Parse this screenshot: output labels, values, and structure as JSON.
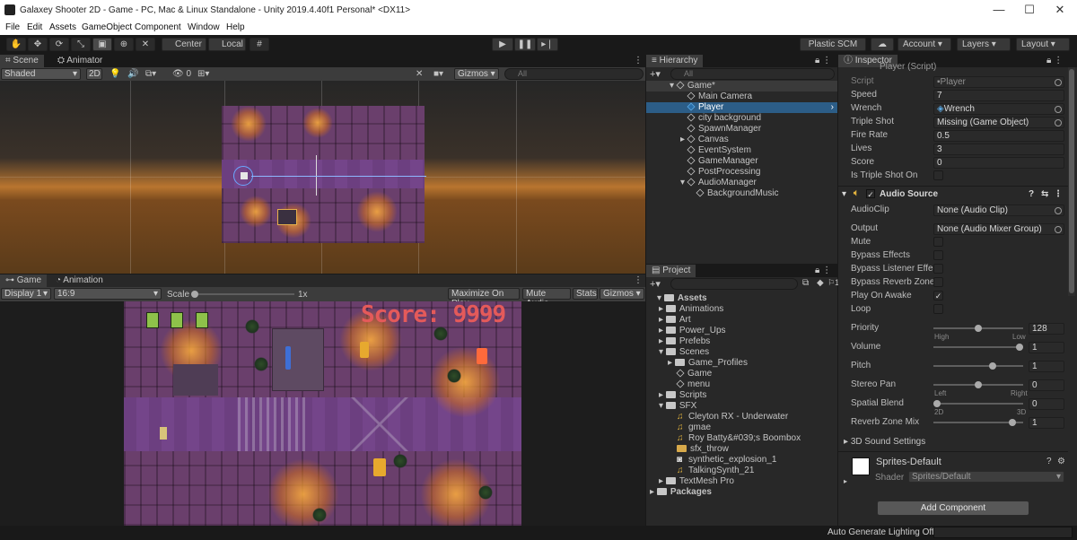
{
  "window": {
    "title": "Galaxey Shooter 2D - Game - PC, Mac & Linux Standalone - Unity 2019.4.40f1 Personal* <DX11>",
    "minimize": "—",
    "maximize": "☐",
    "close": "✕"
  },
  "menu": [
    "File",
    "Edit",
    "Assets",
    "GameObject",
    "Component",
    "Window",
    "Help"
  ],
  "toolbar": {
    "pivot": "Center",
    "space": "Local",
    "plastic": "Plastic SCM",
    "account": "Account",
    "layers": "Layers",
    "layout": "Layout"
  },
  "scene": {
    "tabs": [
      "Scene",
      "Animator"
    ],
    "shading": "Shaded",
    "mode2d": "2D",
    "hidden_count": "0",
    "gizmos": "Gizmos",
    "search_placeholder": "All"
  },
  "game": {
    "tabs": [
      "Game",
      "Animation"
    ],
    "display": "Display 1",
    "aspect": "16:9",
    "scale_label": "Scale",
    "scale_value": "1x",
    "maximize": "Maximize On Play",
    "mute": "Mute Audio",
    "stats": "Stats",
    "gizmos": "Gizmos",
    "score_text": "Score: 9999"
  },
  "hierarchy": {
    "tab": "Hierarchy",
    "search_placeholder": "All",
    "scene": "Game*",
    "items": [
      {
        "label": "Main Camera"
      },
      {
        "label": "Player"
      },
      {
        "label": "city background"
      },
      {
        "label": "SpawnManager"
      },
      {
        "label": "Canvas"
      },
      {
        "label": "EventSystem"
      },
      {
        "label": "GameManager"
      },
      {
        "label": "PostProcessing"
      },
      {
        "label": "AudioManager"
      },
      {
        "label": "BackgroundMusic"
      }
    ]
  },
  "project": {
    "tab": "Project",
    "hidden_count": "1",
    "items": [
      {
        "label": "Assets"
      },
      {
        "label": "Animations"
      },
      {
        "label": "Art"
      },
      {
        "label": "Power_Ups"
      },
      {
        "label": "Prefebs"
      },
      {
        "label": "Scenes"
      },
      {
        "label": "Game_Profiles"
      },
      {
        "label": "Game"
      },
      {
        "label": "menu"
      },
      {
        "label": "Scripts"
      },
      {
        "label": "SFX"
      },
      {
        "label": "Cleyton RX - Underwater"
      },
      {
        "label": "gmae"
      },
      {
        "label": "Roy Batty&#039;s Boombox"
      },
      {
        "label": "sfx_throw"
      },
      {
        "label": "synthetic_explosion_1"
      },
      {
        "label": "TalkingSynth_21"
      },
      {
        "label": "TextMesh Pro"
      },
      {
        "label": "Packages"
      }
    ]
  },
  "inspector": {
    "tab": "Inspector",
    "component_header": "Player (Script)",
    "player_fields": [
      {
        "label": "Script",
        "value": "Player"
      },
      {
        "label": "Speed",
        "value": "7"
      },
      {
        "label": "Wrench",
        "value": "Wrench"
      },
      {
        "label": "Triple Shot",
        "value": "Missing (Game Object)"
      },
      {
        "label": "Fire Rate",
        "value": "0.5"
      },
      {
        "label": "Lives",
        "value": "3"
      },
      {
        "label": "Score",
        "value": "0"
      },
      {
        "label": "Is Triple Shot On",
        "value": ""
      }
    ],
    "audio_source": {
      "title": "Audio Source",
      "audio_clip_label": "AudioClip",
      "audio_clip": "None (Audio Clip)",
      "output_label": "Output",
      "output": "None (Audio Mixer Group)",
      "toggles": [
        {
          "label": "Mute",
          "checked": ""
        },
        {
          "label": "Bypass Effects",
          "checked": ""
        },
        {
          "label": "Bypass Listener Effec",
          "checked": ""
        },
        {
          "label": "Bypass Reverb Zones",
          "checked": ""
        },
        {
          "label": "Play On Awake",
          "checked": "✓"
        },
        {
          "label": "Loop",
          "checked": ""
        }
      ],
      "sliders": [
        {
          "label": "Priority",
          "value": "128",
          "pos": 0.5,
          "left_hint": "High",
          "right_hint": "Low"
        },
        {
          "label": "Volume",
          "value": "1",
          "pos": 1.0,
          "left_hint": "",
          "right_hint": ""
        },
        {
          "label": "Pitch",
          "value": "1",
          "pos": 0.67,
          "left_hint": "",
          "right_hint": ""
        },
        {
          "label": "Stereo Pan",
          "value": "0",
          "pos": 0.5,
          "left_hint": "Left",
          "right_hint": "Right"
        },
        {
          "label": "Spatial Blend",
          "value": "0",
          "pos": 0.0,
          "left_hint": "2D",
          "right_hint": "3D"
        },
        {
          "label": "Reverb Zone Mix",
          "value": "1",
          "pos": 0.91,
          "left_hint": "",
          "right_hint": ""
        }
      ],
      "settings_3d": "3D Sound Settings"
    },
    "material": {
      "name": "Sprites-Default",
      "shader_label": "Shader",
      "shader": "Sprites/Default"
    },
    "add_component": "Add Component"
  },
  "status": {
    "lighting": "Auto Generate Lighting Off"
  },
  "colors": {
    "selection": "#2c5d87",
    "score": "#e45a5a",
    "panel": "#282828"
  }
}
